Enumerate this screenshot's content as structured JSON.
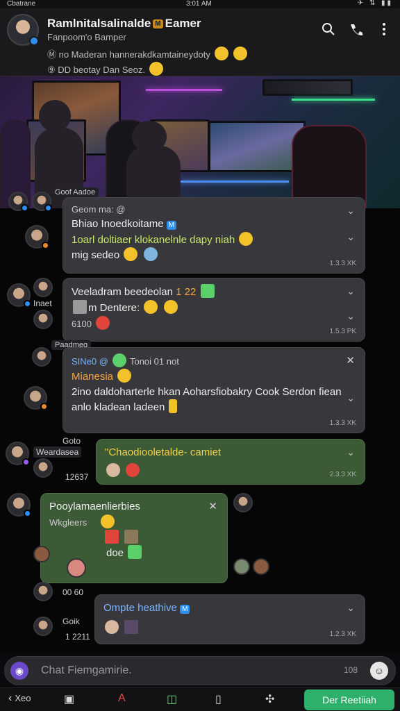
{
  "status_bar": {
    "carrier": "Cbatrane",
    "time": "3:01 AM",
    "icons": "✈ ⇅ ▮▮"
  },
  "header": {
    "title_main": "Ramlnitalsalinalde",
    "title_badge": "M",
    "title_tail": "Eamer",
    "subtitle": "Fanpoom'o Bamper",
    "preview_1": "Ⓜ no Maderan hannerakdkamtaineydoty",
    "preview_2": "⑨ DD beotay Dan Seoz.",
    "actions": [
      "search-icon",
      "call-icon",
      "more-icon"
    ]
  },
  "messages": [
    {
      "tag": "Goof Aadoe",
      "lines": [
        "Geom ma: @",
        "Bhiao Inoedkoitame",
        "1oarl doltiaer klokanelnle dapy niah",
        "mig sedeo"
      ],
      "timestamp": "1.3.3 XK"
    },
    {
      "side_label": "Inaet",
      "lines": [
        "Veeladram beedeolan",
        "m Dentere:",
        "6100"
      ],
      "highlight": "1 22",
      "timestamp": "1.5.3 PK"
    },
    {
      "tag": "Paadmeg",
      "lines": [
        "SINe0 @",
        "Tonoi 01 not",
        "Mianesia",
        "2ino daldoharterle hkan Aoharsfiobakry Cook Serdon fiean",
        "anlo kladean ladeen"
      ],
      "timestamp": "1.3.3 XK"
    },
    {
      "side_labels": [
        "Goto",
        "Weardasea",
        "12637"
      ],
      "lines": [
        "\"Chaodiooletalde- camiet"
      ],
      "timestamp": "2.3.3 XK"
    },
    {
      "lines": [
        "Pooylamaenlierbies",
        "Wkgleers",
        "doe"
      ]
    },
    {
      "side_labels": [
        "00 60",
        "Goik",
        "1 2211"
      ],
      "lines": [
        "Ompte heathive",
        "M"
      ],
      "timestamp": "1.2.3 XK"
    }
  ],
  "compose": {
    "placeholder": "Chat Fiemgamirie.",
    "count": "108"
  },
  "bottom_bar": {
    "back_label": "Xeo",
    "primary_button": "Der Reetiiah"
  }
}
